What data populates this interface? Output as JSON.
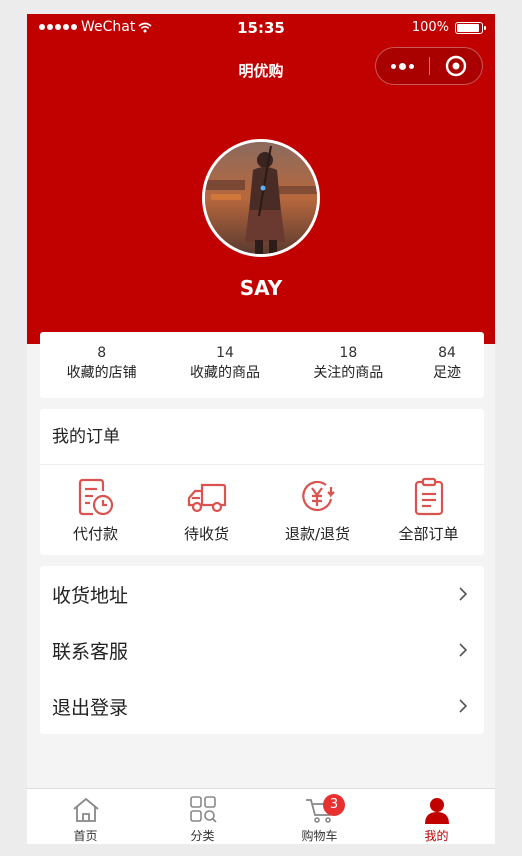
{
  "status_bar": {
    "carrier": "WeChat",
    "time": "15:35",
    "battery": "100%",
    "battery_level": 1.0
  },
  "nav": {
    "title": "明优购"
  },
  "profile": {
    "username": "SAY"
  },
  "stats": [
    {
      "value": "8",
      "label": "收藏的店铺"
    },
    {
      "value": "14",
      "label": "收藏的商品"
    },
    {
      "value": "18",
      "label": "关注的商品"
    },
    {
      "value": "84",
      "label": "足迹"
    }
  ],
  "orders": {
    "title": "我的订单",
    "items": [
      {
        "label": "代付款",
        "icon": "pending-payment-icon"
      },
      {
        "label": "待收货",
        "icon": "delivery-truck-icon"
      },
      {
        "label": "退款/退货",
        "icon": "refund-icon"
      },
      {
        "label": "全部订单",
        "icon": "clipboard-icon"
      }
    ]
  },
  "menu": [
    {
      "label": "收货地址"
    },
    {
      "label": "联系客服"
    },
    {
      "label": "退出登录"
    }
  ],
  "tabbar": {
    "items": [
      {
        "label": "首页",
        "icon": "home-icon"
      },
      {
        "label": "分类",
        "icon": "category-icon"
      },
      {
        "label": "购物车",
        "icon": "cart-icon",
        "badge": "3"
      },
      {
        "label": "我的",
        "icon": "user-icon",
        "active": true
      }
    ]
  },
  "colors": {
    "brand": "#c10000",
    "badge": "#e83030",
    "icon_line": "#d9534f"
  }
}
